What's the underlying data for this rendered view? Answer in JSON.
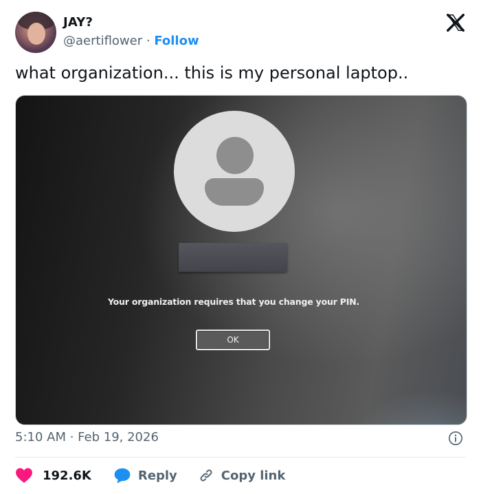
{
  "author": {
    "name": "JAY?",
    "handle": "@aertiflower",
    "separator": "·",
    "follow_label": "Follow"
  },
  "tweet": {
    "text": "what organization... this is my personal laptop..",
    "timestamp": "5:10 AM · Feb 19, 2026"
  },
  "media": {
    "message": "Your organization requires that you change your PIN.",
    "ok_label": "OK"
  },
  "actions": {
    "likes": "192.6K",
    "reply_label": "Reply",
    "copy_label": "Copy link"
  },
  "colors": {
    "accent": "#1d8ff0",
    "like": "#f91880",
    "reply": "#1d8ff0",
    "secondary_text": "#536471"
  },
  "icons": [
    "x-logo-icon",
    "info-icon",
    "heart-icon",
    "reply-bubble-icon",
    "link-icon"
  ]
}
